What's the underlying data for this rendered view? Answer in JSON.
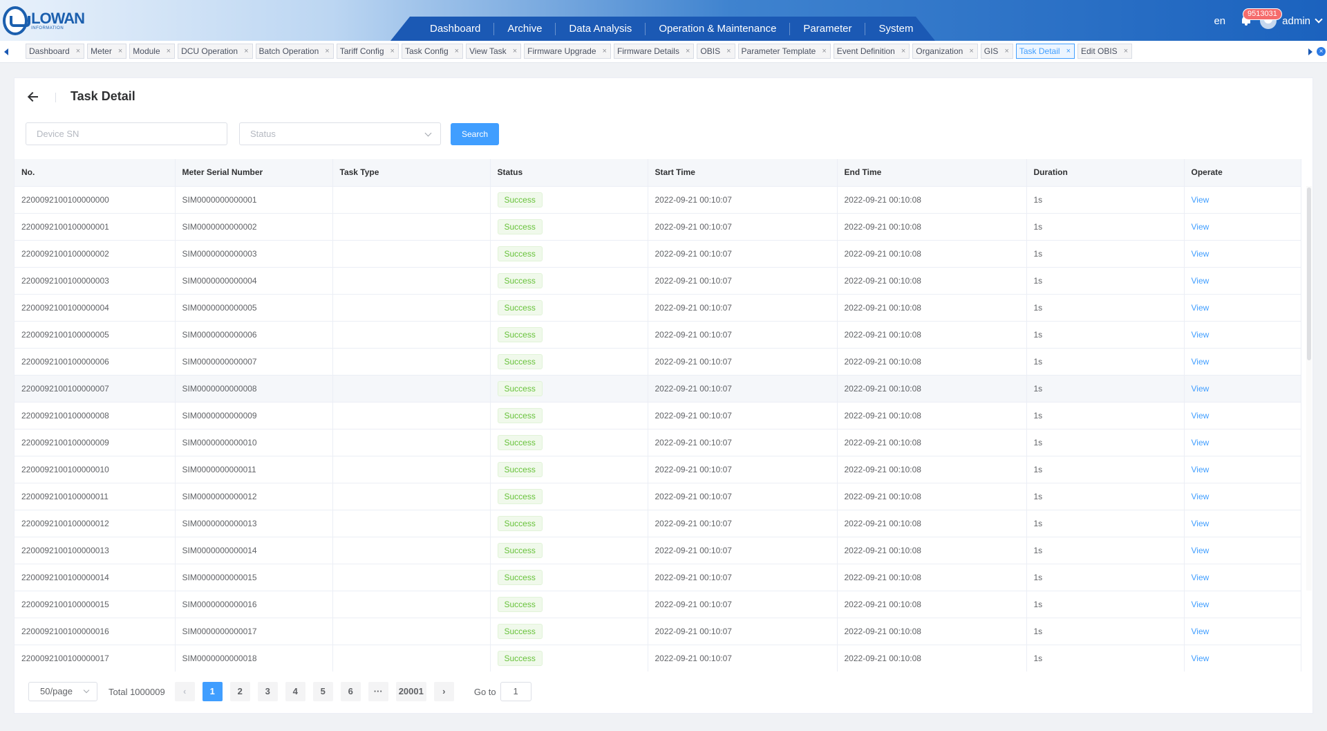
{
  "header": {
    "logo_name": "LOWAN",
    "logo_sub": "INFORMATION",
    "nav": [
      "Dashboard",
      "Archive",
      "Data Analysis",
      "Operation & Maintenance",
      "Parameter",
      "System"
    ],
    "lang": "en",
    "notification_count": "9513031",
    "user": "admin"
  },
  "tabs": [
    {
      "label": "Dashboard",
      "active": false
    },
    {
      "label": "Meter",
      "active": false
    },
    {
      "label": "Module",
      "active": false
    },
    {
      "label": "DCU Operation",
      "active": false
    },
    {
      "label": "Batch Operation",
      "active": false
    },
    {
      "label": "Tariff Config",
      "active": false
    },
    {
      "label": "Task Config",
      "active": false
    },
    {
      "label": "View Task",
      "active": false
    },
    {
      "label": "Firmware Upgrade",
      "active": false
    },
    {
      "label": "Firmware Details",
      "active": false
    },
    {
      "label": "OBIS",
      "active": false
    },
    {
      "label": "Parameter Template",
      "active": false
    },
    {
      "label": "Event Definition",
      "active": false
    },
    {
      "label": "Organization",
      "active": false
    },
    {
      "label": "GIS",
      "active": false
    },
    {
      "label": "Task Detail",
      "active": true
    },
    {
      "label": "Edit OBIS",
      "active": false
    }
  ],
  "page": {
    "title": "Task Detail",
    "device_sn_placeholder": "Device SN",
    "status_placeholder": "Status",
    "search_label": "Search"
  },
  "table": {
    "columns": [
      "No.",
      "Meter Serial Number",
      "Task Type",
      "Status",
      "Start Time",
      "End Time",
      "Duration",
      "Operate"
    ],
    "rows": [
      {
        "no": "2200092100100000000",
        "sn": "SIM0000000000001",
        "type": "",
        "status": "Success",
        "start": "2022-09-21 00:10:07",
        "end": "2022-09-21 00:10:08",
        "duration": "1s",
        "op": "View"
      },
      {
        "no": "2200092100100000001",
        "sn": "SIM0000000000002",
        "type": "",
        "status": "Success",
        "start": "2022-09-21 00:10:07",
        "end": "2022-09-21 00:10:08",
        "duration": "1s",
        "op": "View"
      },
      {
        "no": "2200092100100000002",
        "sn": "SIM0000000000003",
        "type": "",
        "status": "Success",
        "start": "2022-09-21 00:10:07",
        "end": "2022-09-21 00:10:08",
        "duration": "1s",
        "op": "View"
      },
      {
        "no": "2200092100100000003",
        "sn": "SIM0000000000004",
        "type": "",
        "status": "Success",
        "start": "2022-09-21 00:10:07",
        "end": "2022-09-21 00:10:08",
        "duration": "1s",
        "op": "View"
      },
      {
        "no": "2200092100100000004",
        "sn": "SIM0000000000005",
        "type": "",
        "status": "Success",
        "start": "2022-09-21 00:10:07",
        "end": "2022-09-21 00:10:08",
        "duration": "1s",
        "op": "View"
      },
      {
        "no": "2200092100100000005",
        "sn": "SIM0000000000006",
        "type": "",
        "status": "Success",
        "start": "2022-09-21 00:10:07",
        "end": "2022-09-21 00:10:08",
        "duration": "1s",
        "op": "View"
      },
      {
        "no": "2200092100100000006",
        "sn": "SIM0000000000007",
        "type": "",
        "status": "Success",
        "start": "2022-09-21 00:10:07",
        "end": "2022-09-21 00:10:08",
        "duration": "1s",
        "op": "View"
      },
      {
        "no": "2200092100100000007",
        "sn": "SIM0000000000008",
        "type": "",
        "status": "Success",
        "start": "2022-09-21 00:10:07",
        "end": "2022-09-21 00:10:08",
        "duration": "1s",
        "op": "View"
      },
      {
        "no": "2200092100100000008",
        "sn": "SIM0000000000009",
        "type": "",
        "status": "Success",
        "start": "2022-09-21 00:10:07",
        "end": "2022-09-21 00:10:08",
        "duration": "1s",
        "op": "View"
      },
      {
        "no": "2200092100100000009",
        "sn": "SIM0000000000010",
        "type": "",
        "status": "Success",
        "start": "2022-09-21 00:10:07",
        "end": "2022-09-21 00:10:08",
        "duration": "1s",
        "op": "View"
      },
      {
        "no": "2200092100100000010",
        "sn": "SIM0000000000011",
        "type": "",
        "status": "Success",
        "start": "2022-09-21 00:10:07",
        "end": "2022-09-21 00:10:08",
        "duration": "1s",
        "op": "View"
      },
      {
        "no": "2200092100100000011",
        "sn": "SIM0000000000012",
        "type": "",
        "status": "Success",
        "start": "2022-09-21 00:10:07",
        "end": "2022-09-21 00:10:08",
        "duration": "1s",
        "op": "View"
      },
      {
        "no": "2200092100100000012",
        "sn": "SIM0000000000013",
        "type": "",
        "status": "Success",
        "start": "2022-09-21 00:10:07",
        "end": "2022-09-21 00:10:08",
        "duration": "1s",
        "op": "View"
      },
      {
        "no": "2200092100100000013",
        "sn": "SIM0000000000014",
        "type": "",
        "status": "Success",
        "start": "2022-09-21 00:10:07",
        "end": "2022-09-21 00:10:08",
        "duration": "1s",
        "op": "View"
      },
      {
        "no": "2200092100100000014",
        "sn": "SIM0000000000015",
        "type": "",
        "status": "Success",
        "start": "2022-09-21 00:10:07",
        "end": "2022-09-21 00:10:08",
        "duration": "1s",
        "op": "View"
      },
      {
        "no": "2200092100100000015",
        "sn": "SIM0000000000016",
        "type": "",
        "status": "Success",
        "start": "2022-09-21 00:10:07",
        "end": "2022-09-21 00:10:08",
        "duration": "1s",
        "op": "View"
      },
      {
        "no": "2200092100100000016",
        "sn": "SIM0000000000017",
        "type": "",
        "status": "Success",
        "start": "2022-09-21 00:10:07",
        "end": "2022-09-21 00:10:08",
        "duration": "1s",
        "op": "View"
      },
      {
        "no": "2200092100100000017",
        "sn": "SIM0000000000018",
        "type": "",
        "status": "Success",
        "start": "2022-09-21 00:10:07",
        "end": "2022-09-21 00:10:08",
        "duration": "1s",
        "op": "View"
      }
    ]
  },
  "pagination": {
    "page_size": "50/page",
    "total": "Total 1000009",
    "pages": [
      "1",
      "2",
      "3",
      "4",
      "5",
      "6"
    ],
    "ellipsis": "···",
    "last_page": "20001",
    "goto_label": "Go to",
    "goto_value": "1",
    "prev": "‹",
    "next": "›"
  },
  "colors": {
    "primary": "#409eff",
    "nav_bg": "#1b59b4",
    "success": "#67c23a",
    "badge": "#f56c6c"
  }
}
